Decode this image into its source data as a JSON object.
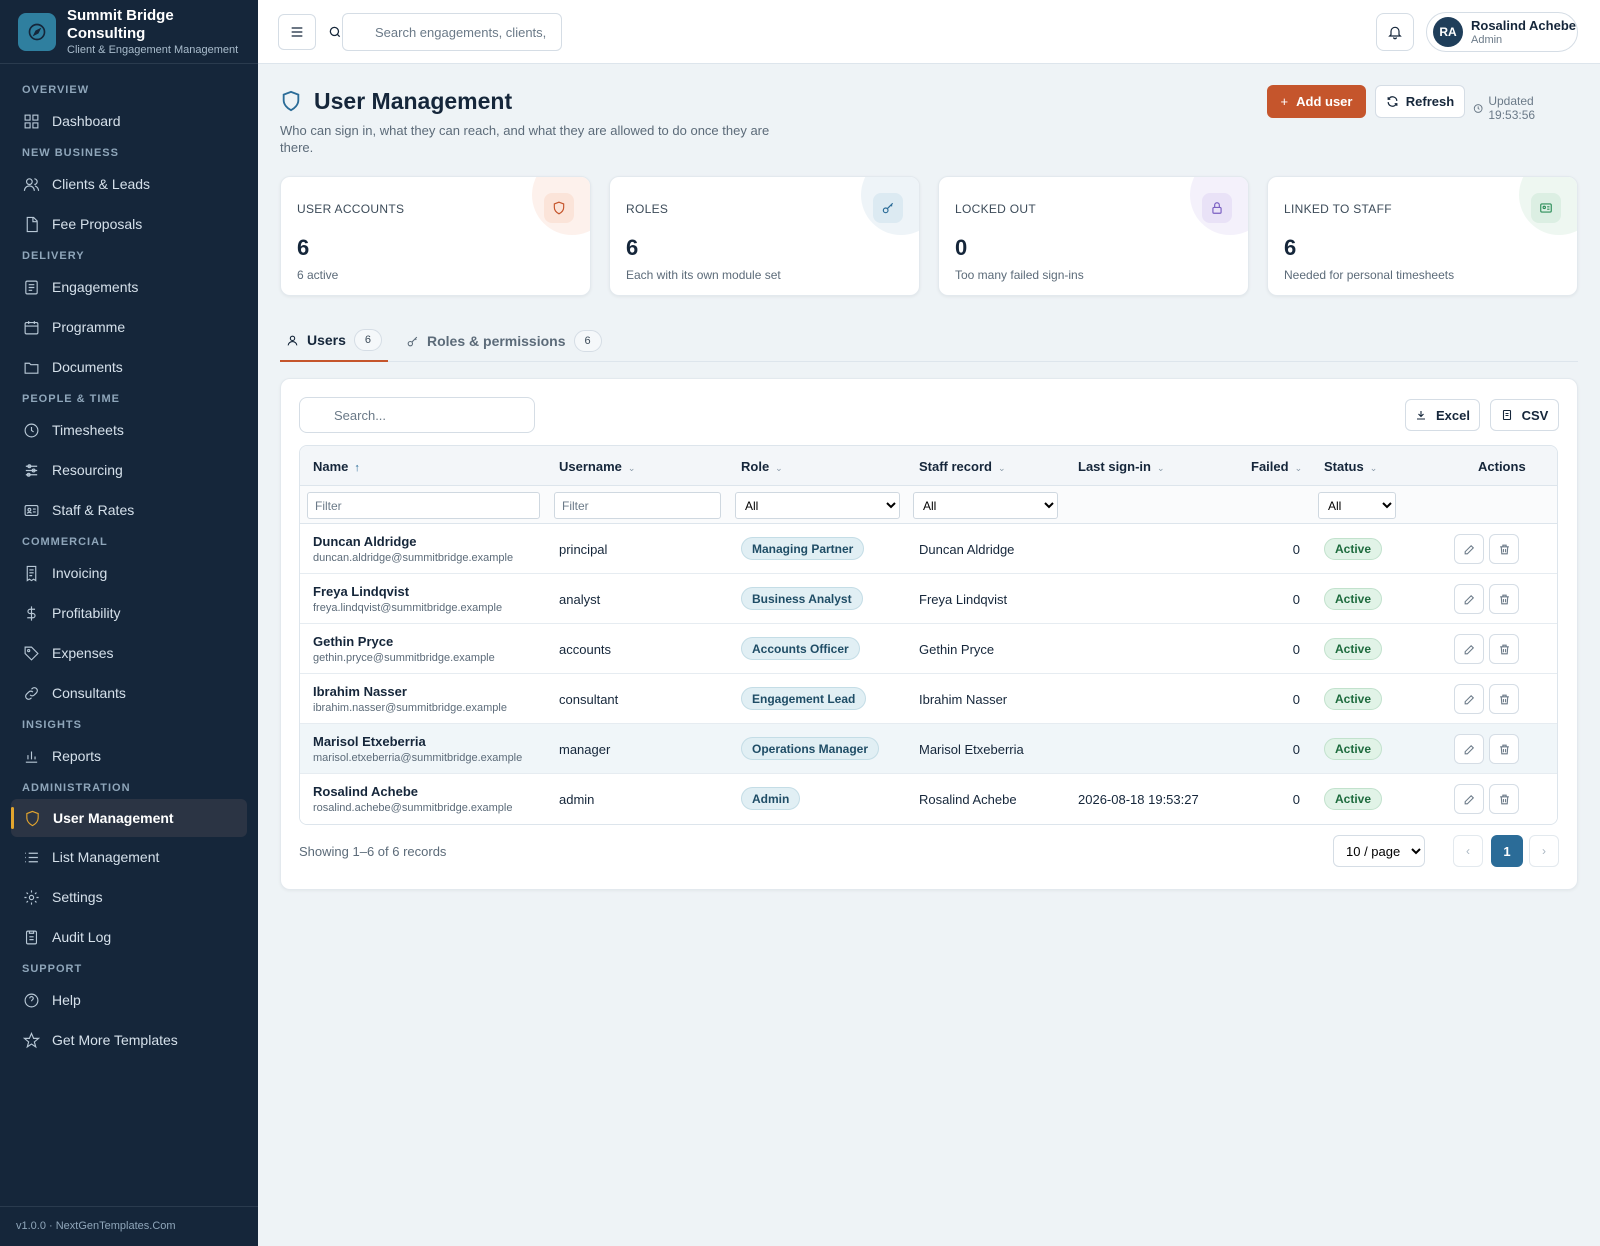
{
  "brand": {
    "title": "Summit Bridge Consulting",
    "subtitle": "Client & Engagement Management"
  },
  "sidebar": {
    "sections": [
      {
        "label": "OVERVIEW"
      },
      {
        "label": "NEW BUSINESS"
      },
      {
        "label": "DELIVERY"
      },
      {
        "label": "PEOPLE & TIME"
      },
      {
        "label": "COMMERCIAL"
      },
      {
        "label": "INSIGHTS"
      },
      {
        "label": "ADMINISTRATION"
      },
      {
        "label": "SUPPORT"
      }
    ],
    "items": [
      {
        "label": "Dashboard",
        "icon": "dashboard-icon"
      },
      {
        "label": "Clients & Leads",
        "icon": "users-icon"
      },
      {
        "label": "Fee Proposals",
        "icon": "document-icon"
      },
      {
        "label": "Engagements",
        "icon": "clipboard-icon"
      },
      {
        "label": "Programme",
        "icon": "calendar-icon"
      },
      {
        "label": "Documents",
        "icon": "folder-icon"
      },
      {
        "label": "Timesheets",
        "icon": "clock-icon"
      },
      {
        "label": "Resourcing",
        "icon": "sliders-icon"
      },
      {
        "label": "Staff & Rates",
        "icon": "id-card-icon"
      },
      {
        "label": "Invoicing",
        "icon": "invoice-icon"
      },
      {
        "label": "Profitability",
        "icon": "dollar-icon"
      },
      {
        "label": "Expenses",
        "icon": "tag-icon"
      },
      {
        "label": "Consultants",
        "icon": "link-icon"
      },
      {
        "label": "Reports",
        "icon": "bar-chart-icon"
      },
      {
        "label": "User Management",
        "icon": "shield-icon"
      },
      {
        "label": "List Management",
        "icon": "list-icon"
      },
      {
        "label": "Settings",
        "icon": "gear-icon"
      },
      {
        "label": "Audit Log",
        "icon": "clipboard-list-icon"
      },
      {
        "label": "Help",
        "icon": "help-circle-icon"
      },
      {
        "label": "Get More Templates",
        "icon": "star-icon"
      }
    ],
    "footer": "v1.0.0 · NextGenTemplates.Com"
  },
  "topbar": {
    "search_placeholder": "Search engagements, clients, s",
    "user": {
      "initials": "RA",
      "name": "Rosalind Achebe",
      "role": "Admin"
    }
  },
  "page": {
    "title": "User Management",
    "description": "Who can sign in, what they can reach, and what they are allowed to do once they are there.",
    "add_label": "Add user",
    "refresh_label": "Refresh",
    "updated": "Updated 19:53:56"
  },
  "stats": [
    {
      "label": "USER ACCOUNTS",
      "value": "6",
      "sub": "6 active",
      "icon": "shield-icon",
      "color": "#c5552c"
    },
    {
      "label": "ROLES",
      "value": "6",
      "sub": "Each with its own module set",
      "icon": "key-icon",
      "color": "#2b6c98"
    },
    {
      "label": "LOCKED OUT",
      "value": "0",
      "sub": "Too many failed sign-ins",
      "icon": "lock-icon",
      "color": "#7a5fc2"
    },
    {
      "label": "LINKED TO STAFF",
      "value": "6",
      "sub": "Needed for personal timesheets",
      "icon": "id-card-icon",
      "color": "#2e8f5a"
    }
  ],
  "tabs": [
    {
      "label": "Users",
      "count": "6"
    },
    {
      "label": "Roles & permissions",
      "count": "6"
    }
  ],
  "table": {
    "search_placeholder": "Search...",
    "excel_label": "Excel",
    "csv_label": "CSV",
    "columns": [
      "Name",
      "Username",
      "Role",
      "Staff record",
      "Last sign-in",
      "Failed",
      "Status",
      "Actions"
    ],
    "filter_placeholder": "Filter",
    "filter_all": "All",
    "rows": [
      {
        "name": "Duncan Aldridge",
        "email": "duncan.aldridge@summitbridge.example",
        "username": "principal",
        "role": "Managing Partner",
        "staff": "Duncan Aldridge",
        "last": "",
        "failed": "0",
        "status": "Active"
      },
      {
        "name": "Freya Lindqvist",
        "email": "freya.lindqvist@summitbridge.example",
        "username": "analyst",
        "role": "Business Analyst",
        "staff": "Freya Lindqvist",
        "last": "",
        "failed": "0",
        "status": "Active"
      },
      {
        "name": "Gethin Pryce",
        "email": "gethin.pryce@summitbridge.example",
        "username": "accounts",
        "role": "Accounts Officer",
        "staff": "Gethin Pryce",
        "last": "",
        "failed": "0",
        "status": "Active"
      },
      {
        "name": "Ibrahim Nasser",
        "email": "ibrahim.nasser@summitbridge.example",
        "username": "consultant",
        "role": "Engagement Lead",
        "staff": "Ibrahim Nasser",
        "last": "",
        "failed": "0",
        "status": "Active"
      },
      {
        "name": "Marisol Etxeberria",
        "email": "marisol.etxeberria@summitbridge.example",
        "username": "manager",
        "role": "Operations Manager",
        "staff": "Marisol Etxeberria",
        "last": "",
        "failed": "0",
        "status": "Active"
      },
      {
        "name": "Rosalind Achebe",
        "email": "rosalind.achebe@summitbridge.example",
        "username": "admin",
        "role": "Admin",
        "staff": "Rosalind Achebe",
        "last": "2026-08-18 19:53:27",
        "failed": "0",
        "status": "Active"
      }
    ],
    "showing": "Showing 1–6 of 6 records",
    "page_size": "10 / page",
    "current_page": "1"
  }
}
